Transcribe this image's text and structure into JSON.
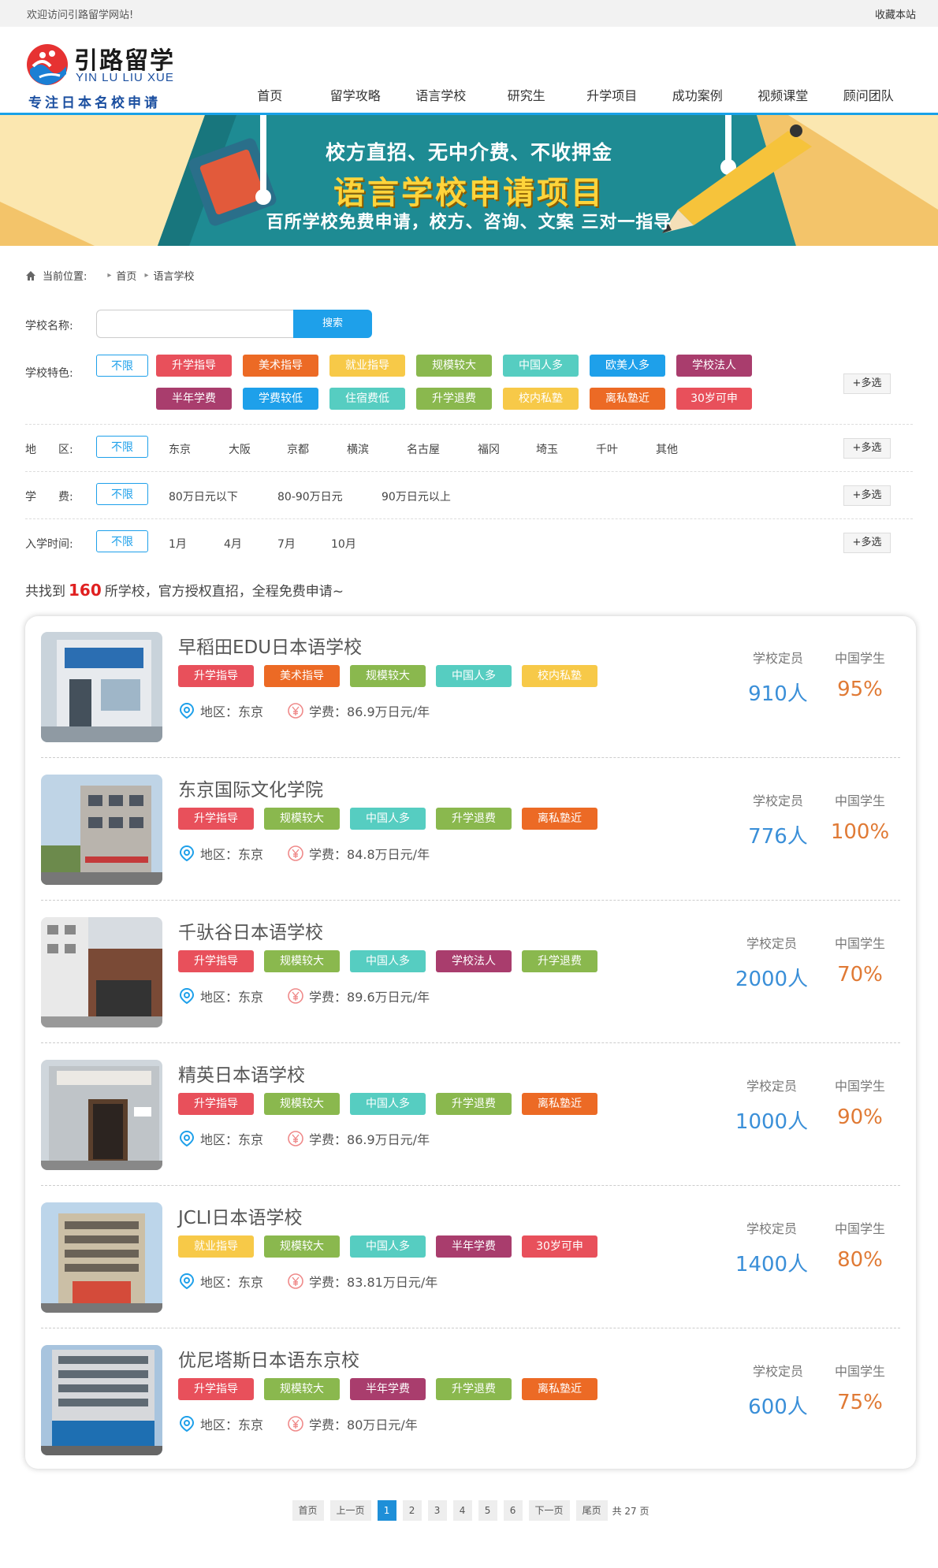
{
  "topbar": {
    "welcome": "欢迎访问引路留学网站!",
    "favorite": "收藏本站"
  },
  "logo": {
    "cn": "引路留学",
    "en": "YIN LU LIU XUE",
    "slogan": "专注日本名校申请"
  },
  "nav": [
    "首页",
    "留学攻略",
    "语言学校",
    "研究生",
    "升学项目",
    "成功案例",
    "视频课堂",
    "顾问团队"
  ],
  "nav_active": "语言学校",
  "banner": {
    "line1": "校方直招、无中介费、不收押金",
    "line2": "语言学校申请项目",
    "line3": "百所学校免费申请，校方、咨询、文案 三对一指导"
  },
  "breadcrumb": {
    "label": "当前位置:",
    "home": "首页",
    "current": "语言学校"
  },
  "search": {
    "label": "学校名称:",
    "placeholder": "",
    "button": "搜索"
  },
  "filters": {
    "feature_label": "学校特色:",
    "any": "不限",
    "multi": "+多选",
    "features": [
      {
        "name": "升学指导",
        "color": "#e8505b"
      },
      {
        "name": "美术指导",
        "color": "#ec6a25"
      },
      {
        "name": "就业指导",
        "color": "#f7c948"
      },
      {
        "name": "规模较大",
        "color": "#8ab84e"
      },
      {
        "name": "中国人多",
        "color": "#56cdc1"
      },
      {
        "name": "欧美人多",
        "color": "#1ea0ea"
      },
      {
        "name": "学校法人",
        "color": "#a93d6d"
      },
      {
        "name": "半年学费",
        "color": "#a93d6d"
      },
      {
        "name": "学费较低",
        "color": "#1ea0ea"
      },
      {
        "name": "住宿费低",
        "color": "#56cdc1"
      },
      {
        "name": "升学退费",
        "color": "#8ab84e"
      },
      {
        "name": "校内私塾",
        "color": "#f7c948"
      },
      {
        "name": "离私塾近",
        "color": "#ec6a25"
      },
      {
        "name": "30岁可申",
        "color": "#e8505b"
      }
    ],
    "region_label": "地　　区:",
    "regions": [
      "东京",
      "大阪",
      "京都",
      "横滨",
      "名古屋",
      "福冈",
      "埼玉",
      "千叶",
      "其他"
    ],
    "fee_label": "学　　费:",
    "fees": [
      "80万日元以下",
      "80-90万日元",
      "90万日元以上"
    ],
    "intake_label": "入学时间:",
    "intakes": [
      "1月",
      "4月",
      "7月",
      "10月"
    ]
  },
  "result": {
    "prefix": "共找到",
    "count": "160",
    "suffix": "所学校，官方授权直招，全程免费申请~"
  },
  "stat_labels": {
    "capacity": "学校定员",
    "chinese": "中国学生"
  },
  "info_labels": {
    "region": "地区：",
    "fee": "学费："
  },
  "tag_colors": {
    "升学指导": "#e8505b",
    "美术指导": "#ec6a25",
    "就业指导": "#f7c948",
    "规模较大": "#8ab84e",
    "中国人多": "#56cdc1",
    "校内私塾": "#f7c948",
    "升学退费": "#8ab84e",
    "离私塾近": "#ec6a25",
    "学校法人": "#a93d6d",
    "半年学费": "#a93d6d",
    "30岁可申": "#e8505b"
  },
  "schools": [
    {
      "name": "早稻田EDU日本语学校",
      "tags": [
        "升学指导",
        "美术指导",
        "规模较大",
        "中国人多",
        "校内私塾"
      ],
      "region": "东京",
      "fee": "86.9万日元/年",
      "capacity": "910人",
      "chinese": "95%"
    },
    {
      "name": "东京国际文化学院",
      "tags": [
        "升学指导",
        "规模较大",
        "中国人多",
        "升学退费",
        "离私塾近"
      ],
      "region": "东京",
      "fee": "84.8万日元/年",
      "capacity": "776人",
      "chinese": "100%"
    },
    {
      "name": "千驮谷日本语学校",
      "tags": [
        "升学指导",
        "规模较大",
        "中国人多",
        "学校法人",
        "升学退费"
      ],
      "region": "东京",
      "fee": "89.6万日元/年",
      "capacity": "2000人",
      "chinese": "70%"
    },
    {
      "name": "精英日本语学校",
      "tags": [
        "升学指导",
        "规模较大",
        "中国人多",
        "升学退费",
        "离私塾近"
      ],
      "region": "东京",
      "fee": "86.9万日元/年",
      "capacity": "1000人",
      "chinese": "90%"
    },
    {
      "name": "JCLI日本语学校",
      "tags": [
        "就业指导",
        "规模较大",
        "中国人多",
        "半年学费",
        "30岁可申"
      ],
      "region": "东京",
      "fee": "83.81万日元/年",
      "capacity": "1400人",
      "chinese": "80%"
    },
    {
      "name": "优尼塔斯日本语东京校",
      "tags": [
        "升学指导",
        "规模较大",
        "半年学费",
        "升学退费",
        "离私塾近"
      ],
      "region": "东京",
      "fee": "80万日元/年",
      "capacity": "600人",
      "chinese": "75%"
    }
  ],
  "pager": {
    "first": "首页",
    "prev": "上一页",
    "pages": [
      "1",
      "2",
      "3",
      "4",
      "5",
      "6"
    ],
    "current": "1",
    "next": "下一页",
    "last": "尾页",
    "total": "共 27 页"
  },
  "colors": {
    "accent": "#1ea0ea",
    "capacity": "#3a8fd8",
    "chinese": "#e07a35",
    "highlight": "#e02020"
  }
}
